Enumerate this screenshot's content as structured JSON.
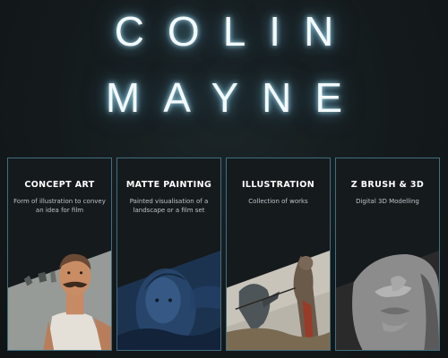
{
  "hero": {
    "name_line_1": "COLIN",
    "name_line_2": "MAYNE"
  },
  "cards": [
    {
      "title": "CONCEPT ART",
      "description": "Form of illustration to convey an idea for film"
    },
    {
      "title": "MATTE PAINTING",
      "description": "Painted visualisation of a landscape or a film set"
    },
    {
      "title": "ILLUSTRATION",
      "description": "Collection of works"
    },
    {
      "title": "Z BRUSH & 3D",
      "description": "Digital 3D Modelling"
    }
  ],
  "colors": {
    "background": "#141a1c",
    "card_border": "#3f6f80",
    "glow": "#8fd3ee"
  }
}
